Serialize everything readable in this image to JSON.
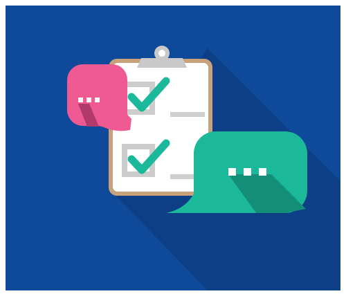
{
  "illustration": {
    "subject": "clipboard-checklist-with-chat-bubbles",
    "icons": [
      "clipboard-icon",
      "checkbox-icon",
      "checkmark-icon",
      "chat-bubble-icon",
      "ellipsis-icon"
    ],
    "colors": {
      "background": "#0f4a9a",
      "long_shadow": "#0c3f85",
      "clipboard_border": "#c8a27a",
      "paper": "#ffffff",
      "clip": "#c9c9c9",
      "checkbox": "#cdcdcd",
      "checkmark": "#1bb99a",
      "line": "#cfcfcf",
      "pink_bubble": "#ee5a91",
      "pink_bubble_shadow": "#b03a6c",
      "green_bubble": "#1bb99a",
      "green_bubble_shadow": "#138f78",
      "dots": "#ffffff"
    },
    "checklist": [
      {
        "checked": true
      },
      {
        "checked": true
      }
    ]
  }
}
